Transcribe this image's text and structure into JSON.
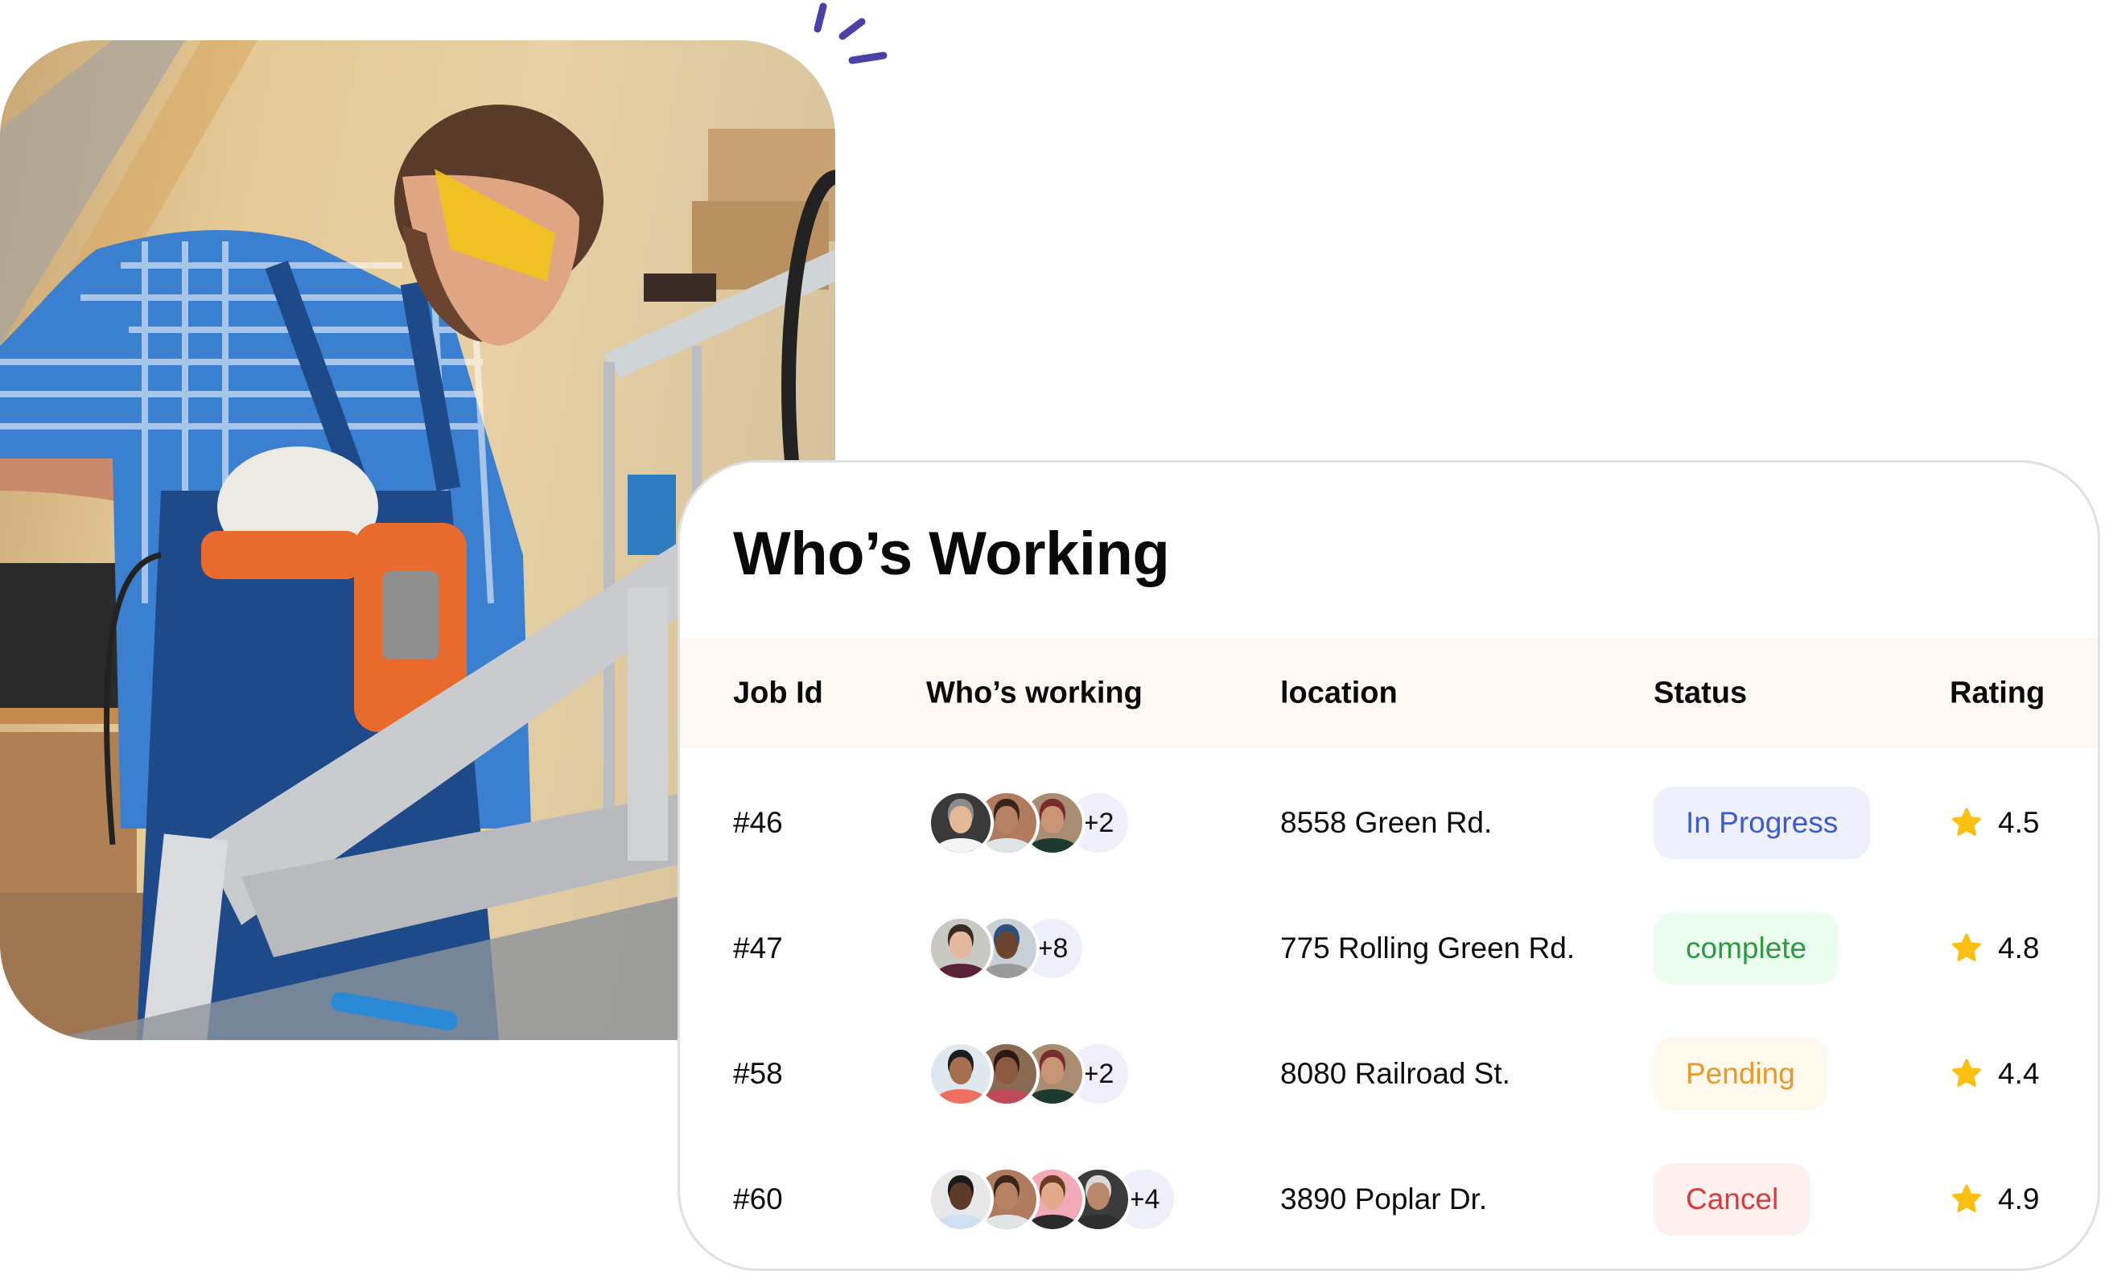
{
  "hero_photo": {
    "alt": "Bearded worker in blue checkered shirt, denim apron, yellow safety glasses and white gloves drilling a bicycle frame in a workshop"
  },
  "accent": {
    "icon": "sparkle-lines-icon",
    "color": "#4b3fa8"
  },
  "card": {
    "title": "Who’s Working",
    "columns": [
      "Job Id",
      "Who’s working",
      "location",
      "Status",
      "Rating"
    ],
    "rows": [
      {
        "job_id": "#46",
        "workers": [
          {
            "skin": "#e2b896",
            "hair": "#8c8c8c",
            "bg": "#3a3a3a",
            "shirt": "#f4f4f4"
          },
          {
            "skin": "#b88362",
            "hair": "#3a2618",
            "bg": "#b07a5e",
            "shirt": "#dfe5e6"
          },
          {
            "skin": "#c99574",
            "hair": "#7a2c2c",
            "bg": "#a98d72",
            "shirt": "#1d3a30"
          }
        ],
        "extra_count": "+2",
        "location": "8558 Green Rd.",
        "status": {
          "label": "In Progress",
          "text_color": "#3b5bd1",
          "bg_color": "#eef1fd"
        },
        "rating": "4.5"
      },
      {
        "job_id": "#47",
        "workers": [
          {
            "skin": "#e3b89e",
            "hair": "#3a2a22",
            "bg": "#c9c9c4",
            "shirt": "#5b2138"
          },
          {
            "skin": "#6b4530",
            "hair": "#2e4e7e",
            "bg": "#c8cfd6",
            "shirt": "#9a9a9a"
          }
        ],
        "extra_count": "+8",
        "location": "775 Rolling Green Rd.",
        "status": {
          "label": "complete",
          "text_color": "#2e9a44",
          "bg_color": "#ebfdef"
        },
        "rating": "4.8"
      },
      {
        "job_id": "#58",
        "workers": [
          {
            "skin": "#a5704f",
            "hair": "#1d1d1d",
            "bg": "#dfe8ee",
            "shirt": "#ef6f60"
          },
          {
            "skin": "#8b5a3e",
            "hair": "#2b1a12",
            "bg": "#8a6a52",
            "shirt": "#c04a5a"
          },
          {
            "skin": "#c99574",
            "hair": "#7a2c2c",
            "bg": "#a98d72",
            "shirt": "#1d3a30"
          }
        ],
        "extra_count": "+2",
        "location": "8080 Railroad St.",
        "status": {
          "label": "Pending",
          "text_color": "#e79a2b",
          "bg_color": "#fff8ec"
        },
        "rating": "4.4"
      },
      {
        "job_id": "#60",
        "workers": [
          {
            "skin": "#5e3b28",
            "hair": "#1a1a1a",
            "bg": "#e6e8ea",
            "shirt": "#cfe0f2"
          },
          {
            "skin": "#b88362",
            "hair": "#3a2618",
            "bg": "#b07a5e",
            "shirt": "#dfe5e6"
          },
          {
            "skin": "#e2a98a",
            "hair": "#6b3b22",
            "bg": "#f2a9b8",
            "shirt": "#2a2a2a"
          },
          {
            "skin": "#b9876a",
            "hair": "#d9d9d9",
            "bg": "#3b3b3b",
            "shirt": "#2e2e2e"
          }
        ],
        "extra_count": "+4",
        "location": "3890 Poplar Dr.",
        "status": {
          "label": "Cancel",
          "text_color": "#dc3a3a",
          "bg_color": "#fff0f0"
        },
        "rating": "4.9"
      }
    ],
    "rating_icon": "star-icon",
    "star_color": "#fbbf0f"
  }
}
